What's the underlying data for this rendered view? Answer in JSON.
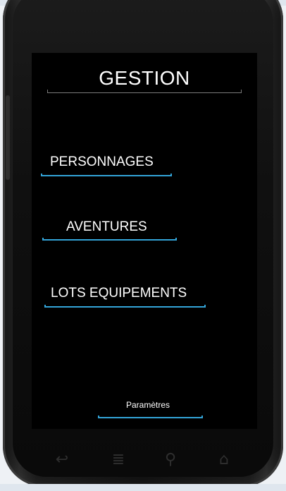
{
  "app": {
    "title": "GESTION"
  },
  "menu": {
    "items": [
      {
        "label": "PERSONNAGES"
      },
      {
        "label": "AVENTURES"
      },
      {
        "label": "LOTS EQUIPEMENTS"
      }
    ],
    "settings_label": "Paramètres"
  },
  "device": {
    "nav_keys": [
      {
        "icon": "back-icon",
        "glyph": "↩"
      },
      {
        "icon": "menu-icon",
        "glyph": "≣"
      },
      {
        "icon": "search-icon",
        "glyph": "⚲"
      },
      {
        "icon": "home-icon",
        "glyph": "⌂"
      }
    ]
  },
  "colors": {
    "accent": "#33a4d8",
    "screen_background": "#000000",
    "text": "#ffffff"
  }
}
